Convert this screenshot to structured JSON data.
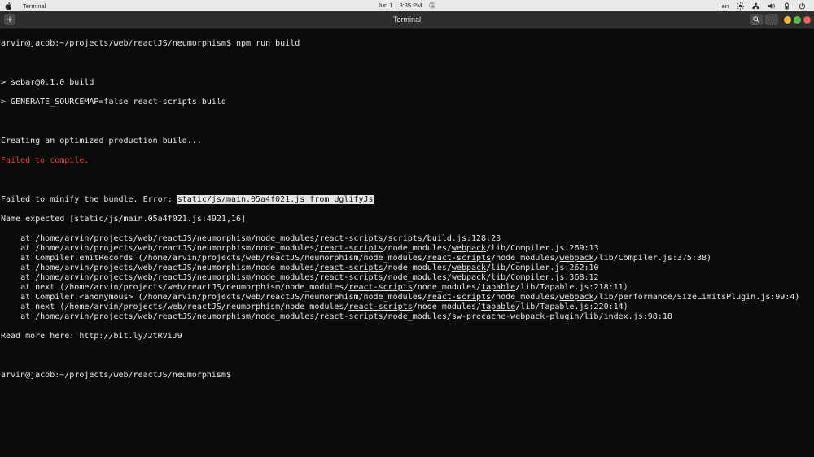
{
  "menubar": {
    "app_name": "Terminal",
    "date": "Jun 1",
    "time": "8:35 PM",
    "lang": "en",
    "icons": [
      "apple-icon",
      "brightness-icon",
      "network-icon",
      "volume-icon",
      "battery-icon",
      "power-icon"
    ]
  },
  "titlebar": {
    "title": "Terminal",
    "new_tab": "+",
    "menu": "⋯",
    "colors": {
      "close": "#ed5f57",
      "minimize": "#e9b93b",
      "maximize": "#5ac144"
    }
  },
  "terminal": {
    "prompt_command": "arvin@jacob:~/projects/web/reactJS/neumorphism$ npm run build",
    "line_pkg": "> sebar@0.1.0 build",
    "line_script": "> GENERATE_SOURCEMAP=false react-scripts build",
    "line_creating": "Creating an optimized production build...",
    "line_failed": "Failed to compile.",
    "line_minify_prefix": "Failed to minify the bundle. Error: ",
    "line_minify_selected": "static/js/main.05a4f021.js from UglifyJs",
    "line_name_expected": "Name expected [static/js/main.05a4f021.js:4921,16]",
    "stack": [
      [
        "    at /home/arvin/projects/web/reactJS/neumorphism/node_modules/",
        "react-scripts",
        "/scripts/build.js:128:23"
      ],
      [
        "    at /home/arvin/projects/web/reactJS/neumorphism/node_modules/",
        "react-scripts",
        "/node_modules/",
        "webpack",
        "/lib/Compiler.js:269:13"
      ],
      [
        "    at Compiler.emitRecords (/home/arvin/projects/web/reactJS/neumorphism/node_modules/",
        "react-scripts",
        "/node_modules/",
        "webpack",
        "/lib/Compiler.js:375:38)"
      ],
      [
        "    at /home/arvin/projects/web/reactJS/neumorphism/node_modules/",
        "react-scripts",
        "/node_modules/",
        "webpack",
        "/lib/Compiler.js:262:10"
      ],
      [
        "    at /home/arvin/projects/web/reactJS/neumorphism/node_modules/",
        "react-scripts",
        "/node_modules/",
        "webpack",
        "/lib/Compiler.js:368:12"
      ],
      [
        "    at next (/home/arvin/projects/web/reactJS/neumorphism/node_modules/",
        "react-scripts",
        "/node_modules/",
        "tapable",
        "/lib/Tapable.js:218:11)"
      ],
      [
        "    at Compiler.<anonymous> (/home/arvin/projects/web/reactJS/neumorphism/node_modules/",
        "react-scripts",
        "/node_modules/",
        "webpack",
        "/lib/performance/SizeLimitsPlugin.js:99:4)"
      ],
      [
        "    at next (/home/arvin/projects/web/reactJS/neumorphism/node_modules/",
        "react-scripts",
        "/node_modules/",
        "tapable",
        "/lib/Tapable.js:220:14)"
      ],
      [
        "    at /home/arvin/projects/web/reactJS/neumorphism/node_modules/",
        "react-scripts",
        "/node_modules/",
        "sw-precache-webpack-plugin",
        "/lib/index.js:98:18"
      ]
    ],
    "line_read_more": "Read more here: http://bit.ly/2tRViJ9",
    "prompt_final": "arvin@jacob:~/projects/web/reactJS/neumorphism$"
  }
}
